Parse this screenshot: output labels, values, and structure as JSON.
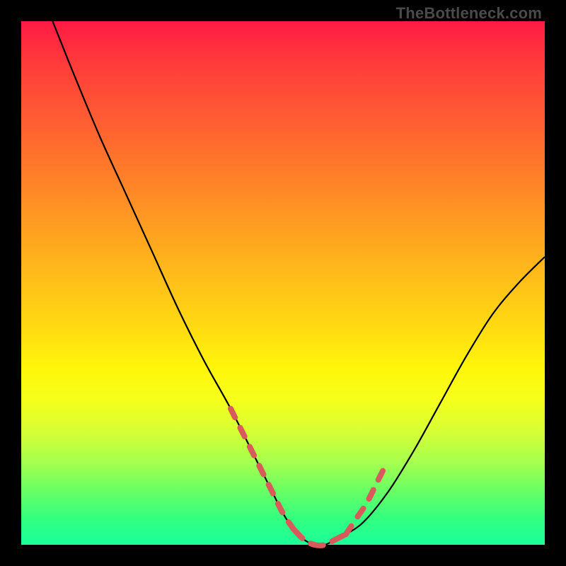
{
  "watermark": "TheBottleneck.com",
  "chart_data": {
    "type": "line",
    "title": "",
    "xlabel": "",
    "ylabel": "",
    "xlim": [
      0,
      100
    ],
    "ylim": [
      0,
      100
    ],
    "grid": false,
    "legend": false,
    "series": [
      {
        "name": "bottleneck-curve",
        "stroke": "#000000",
        "x": [
          6,
          10,
          15,
          20,
          25,
          30,
          35,
          40,
          45,
          48,
          50,
          52,
          54,
          56,
          58,
          60,
          65,
          70,
          75,
          80,
          85,
          90,
          95,
          100
        ],
        "y": [
          100,
          90,
          78,
          67,
          56,
          45,
          35,
          26,
          16,
          10,
          6,
          3,
          1,
          0,
          0,
          1,
          4,
          10,
          18,
          27,
          36,
          44,
          50,
          55
        ]
      },
      {
        "name": "highlight-dashes-left",
        "stroke": "#d85a5a",
        "style": "dashed",
        "x": [
          40,
          42,
          44,
          46,
          48,
          50,
          52
        ],
        "y": [
          26,
          22,
          18,
          14,
          10,
          6,
          3
        ]
      },
      {
        "name": "highlight-dashes-bottom",
        "stroke": "#d85a5a",
        "style": "dashed",
        "x": [
          52,
          54,
          56,
          58,
          60,
          62
        ],
        "y": [
          3,
          1,
          0,
          0,
          1,
          2
        ]
      },
      {
        "name": "highlight-dashes-right",
        "stroke": "#d85a5a",
        "style": "dashed",
        "x": [
          62,
          64,
          66,
          68,
          70
        ],
        "y": [
          2,
          5,
          8,
          12,
          16
        ]
      }
    ],
    "background_gradient": {
      "direction": "vertical",
      "stops": [
        {
          "pos": 0,
          "color": "#ff1a44"
        },
        {
          "pos": 50,
          "color": "#ffd000"
        },
        {
          "pos": 72,
          "color": "#fff50a"
        },
        {
          "pos": 100,
          "color": "#1aff99"
        }
      ]
    }
  }
}
